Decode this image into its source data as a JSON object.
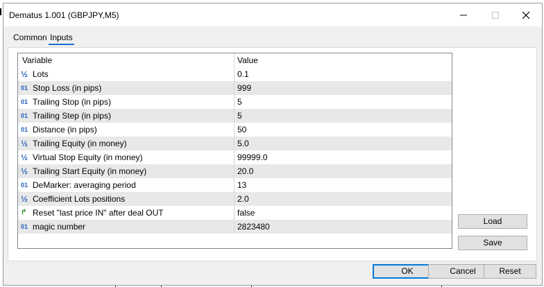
{
  "window": {
    "title": "Dematus 1.001 (GBPJPY,M5)",
    "controls": [
      "minimize-icon",
      "maximize-icon",
      "close-icon"
    ]
  },
  "tabs": [
    {
      "label": "Common",
      "active": false
    },
    {
      "label": "Inputs",
      "active": true
    }
  ],
  "grid": {
    "headers": {
      "variable": "Variable",
      "value": "Value"
    },
    "rows": [
      {
        "type": "double",
        "icon": "½",
        "variable": "Lots",
        "value": "0.1"
      },
      {
        "type": "int",
        "icon": "01",
        "variable": "Stop Loss (in pips)",
        "value": "999"
      },
      {
        "type": "int",
        "icon": "01",
        "variable": "Trailing Stop (in pips)",
        "value": "5"
      },
      {
        "type": "int",
        "icon": "01",
        "variable": "Trailing Step (in pips)",
        "value": "5"
      },
      {
        "type": "int",
        "icon": "01",
        "variable": "Distance (in pips)",
        "value": "50"
      },
      {
        "type": "double",
        "icon": "½",
        "variable": "Trailing Equity (in money)",
        "value": "5.0"
      },
      {
        "type": "double",
        "icon": "½",
        "variable": "Virtual Stop Equity (in money)",
        "value": "99999.0"
      },
      {
        "type": "double",
        "icon": "½",
        "variable": "Trailing Start Equity (in money)",
        "value": "20.0"
      },
      {
        "type": "int",
        "icon": "01",
        "variable": "DeMarker: averaging period",
        "value": "13"
      },
      {
        "type": "double",
        "icon": "½",
        "variable": "Coefficient Lots positions",
        "value": "2.0"
      },
      {
        "type": "bool",
        "icon": "↱",
        "variable": "Reset \"last price IN\" after deal OUT",
        "value": "false"
      },
      {
        "type": "int",
        "icon": "01",
        "variable": "magic number",
        "value": "2823480"
      }
    ]
  },
  "side_buttons": {
    "load": "Load",
    "save": "Save"
  },
  "footer_buttons": {
    "ok": "OK",
    "cancel": "Cancel",
    "reset": "Reset"
  },
  "colors": {
    "accent": "#0078d7",
    "tab_underline": "#1e6fd0",
    "int_icon": "#1f5fb8",
    "bool_icon": "#2a9a3a"
  }
}
